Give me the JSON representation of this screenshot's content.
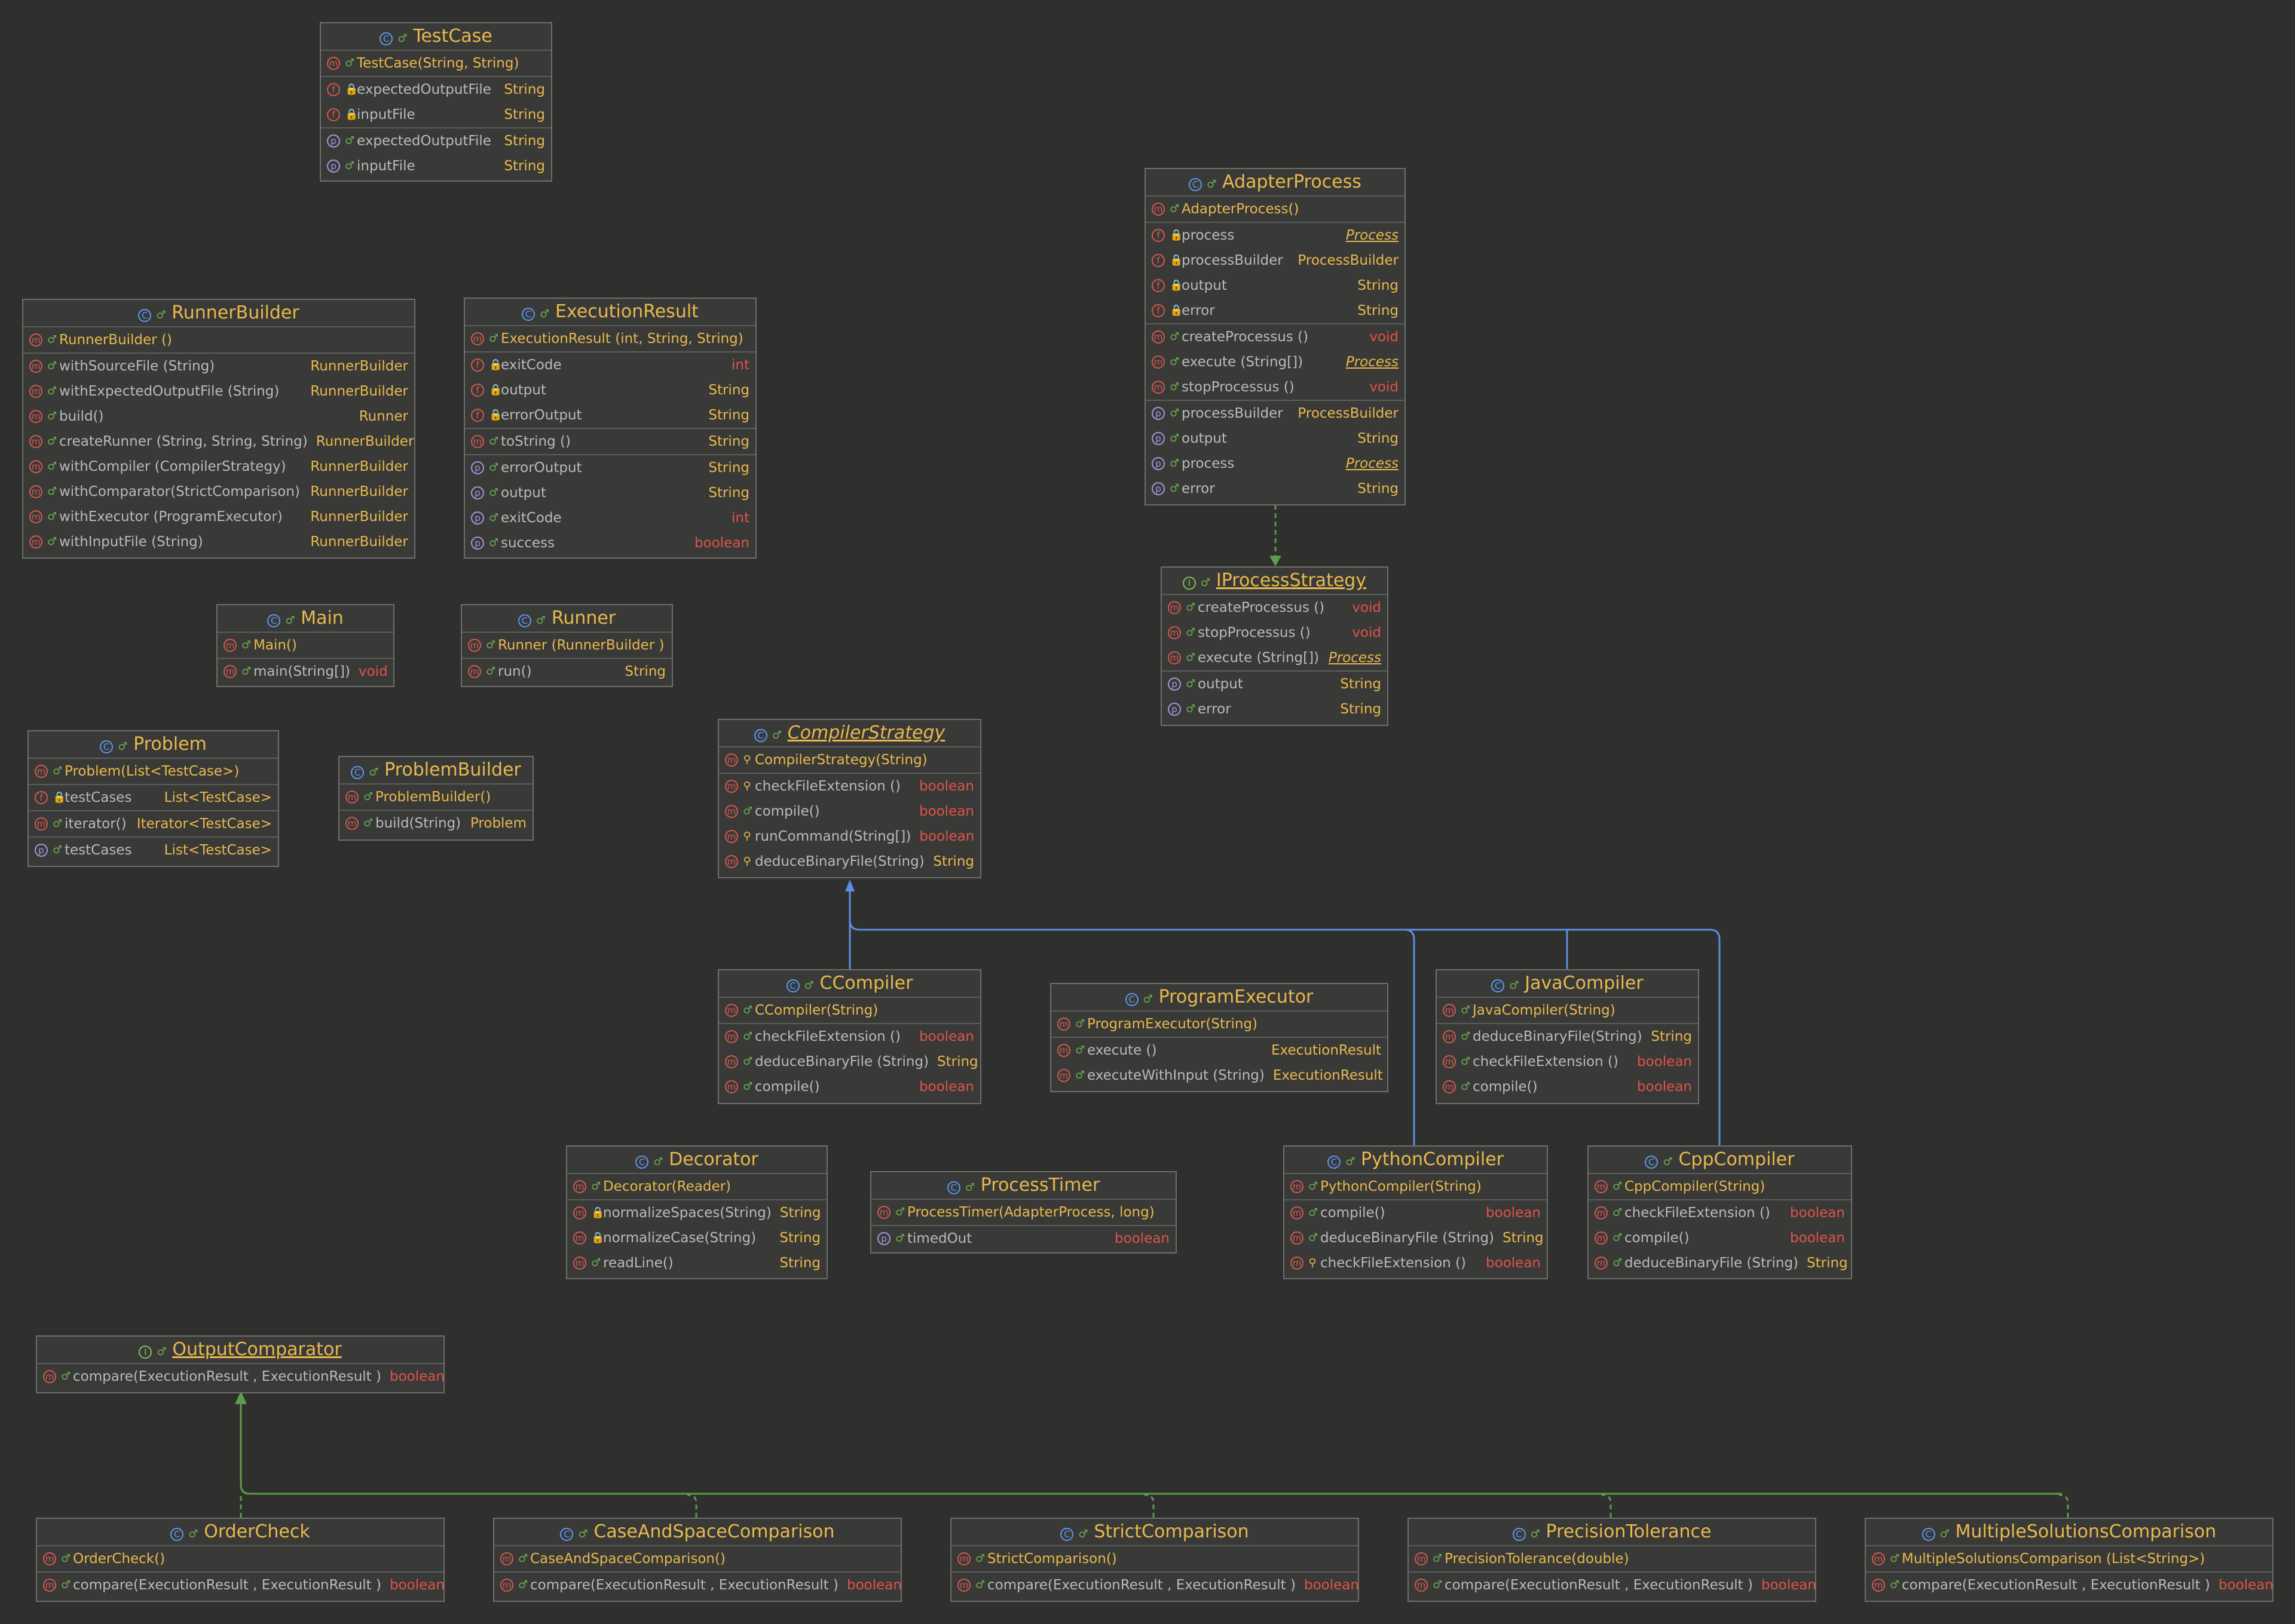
{
  "colors": {
    "background": "#2f2f2d",
    "box": "#393a38",
    "border": "#6d6f6c",
    "accent": "#e8b84c",
    "primitive": "#e0524a",
    "inheritance": "#5d8ee0",
    "realization": "#5e9b4a"
  },
  "classes": {
    "testcase": {
      "kind": "C",
      "title": "TestCase",
      "sections": [
        [
          {
            "k": "m",
            "v": "pub",
            "name": "TestCase(String, String)",
            "ctor": true
          }
        ],
        [
          {
            "k": "f",
            "v": "priv",
            "name": "expectedOutputFile",
            "type": "String"
          },
          {
            "k": "f",
            "v": "priv",
            "name": "inputFile",
            "type": "String"
          }
        ],
        [
          {
            "k": "p",
            "v": "pub",
            "name": "expectedOutputFile",
            "type": "String"
          },
          {
            "k": "p",
            "v": "pub",
            "name": "inputFile",
            "type": "String"
          }
        ]
      ]
    },
    "runnerbuilder": {
      "kind": "C",
      "title": "RunnerBuilder",
      "sections": [
        [
          {
            "k": "m",
            "v": "pub",
            "name": "RunnerBuilder ()",
            "ctor": true
          }
        ],
        [
          {
            "k": "m",
            "v": "pub",
            "name": "withSourceFile (String)",
            "type": "RunnerBuilder"
          },
          {
            "k": "m",
            "v": "pub",
            "name": "withExpectedOutputFile  (String)",
            "type": "RunnerBuilder"
          },
          {
            "k": "m",
            "v": "pub",
            "name": "build()",
            "type": "Runner"
          },
          {
            "k": "m",
            "v": "pub",
            "name": "createRunner (String, String, String)",
            "type": "RunnerBuilder"
          },
          {
            "k": "m",
            "v": "pub",
            "name": "withCompiler (CompilerStrategy)",
            "type": "RunnerBuilder"
          },
          {
            "k": "m",
            "v": "pub",
            "name": "withComparator(StrictComparison)",
            "type": "RunnerBuilder"
          },
          {
            "k": "m",
            "v": "pub",
            "name": "withExecutor (ProgramExecutor)",
            "type": "RunnerBuilder"
          },
          {
            "k": "m",
            "v": "pub",
            "name": "withInputFile  (String)",
            "type": "RunnerBuilder"
          }
        ]
      ]
    },
    "executionresult": {
      "kind": "C",
      "title": "ExecutionResult",
      "sections": [
        [
          {
            "k": "m",
            "v": "pub",
            "name": "ExecutionResult (int, String, String)",
            "ctor": true
          }
        ],
        [
          {
            "k": "f",
            "v": "priv",
            "name": "exitCode",
            "type": "int",
            "red": true
          },
          {
            "k": "f",
            "v": "priv",
            "name": "output",
            "type": "String"
          },
          {
            "k": "f",
            "v": "priv",
            "name": "errorOutput",
            "type": "String"
          }
        ],
        [
          {
            "k": "m",
            "v": "pub",
            "name": "toString ()",
            "type": "String"
          }
        ],
        [
          {
            "k": "p",
            "v": "pub",
            "name": "errorOutput",
            "type": "String"
          },
          {
            "k": "p",
            "v": "pub",
            "name": "output",
            "type": "String"
          },
          {
            "k": "p",
            "v": "pub",
            "name": "exitCode",
            "type": "int",
            "red": true
          },
          {
            "k": "p",
            "v": "pub",
            "name": "success",
            "type": "boolean",
            "red": true
          }
        ]
      ]
    },
    "adapterprocess": {
      "kind": "C",
      "title": "AdapterProcess",
      "sections": [
        [
          {
            "k": "m",
            "v": "pub",
            "name": "AdapterProcess()",
            "ctor": true
          }
        ],
        [
          {
            "k": "f",
            "v": "priv",
            "name": "process",
            "type": "Process",
            "it": true
          },
          {
            "k": "f",
            "v": "priv",
            "name": "processBuilder",
            "type": "ProcessBuilder"
          },
          {
            "k": "f",
            "v": "priv",
            "name": "output",
            "type": "String"
          },
          {
            "k": "f",
            "v": "priv",
            "name": "error",
            "type": "String"
          }
        ],
        [
          {
            "k": "m",
            "v": "pub",
            "name": "createProcessus ()",
            "type": "void",
            "red": true
          },
          {
            "k": "m",
            "v": "pub",
            "name": "execute (String[])",
            "type": "Process",
            "it": true
          },
          {
            "k": "m",
            "v": "pub",
            "name": "stopProcessus ()",
            "type": "void",
            "red": true
          }
        ],
        [
          {
            "k": "p",
            "v": "pub",
            "name": "processBuilder",
            "type": "ProcessBuilder"
          },
          {
            "k": "p",
            "v": "pub",
            "name": "output",
            "type": "String"
          },
          {
            "k": "p",
            "v": "pub",
            "name": "process",
            "type": "Process",
            "it": true
          },
          {
            "k": "p",
            "v": "pub",
            "name": "error",
            "type": "String"
          }
        ]
      ]
    },
    "iprocessstrategy": {
      "kind": "I",
      "title": "IProcessStrategy",
      "sections": [
        [
          {
            "k": "m",
            "v": "pub",
            "name": "createProcessus ()",
            "type": "void",
            "red": true
          },
          {
            "k": "m",
            "v": "pub",
            "name": "stopProcessus ()",
            "type": "void",
            "red": true
          },
          {
            "k": "m",
            "v": "pub",
            "name": "execute (String[])",
            "type": "Process",
            "it": true
          }
        ],
        [
          {
            "k": "p",
            "v": "pub",
            "name": "output",
            "type": "String"
          },
          {
            "k": "p",
            "v": "pub",
            "name": "error",
            "type": "String"
          }
        ]
      ]
    },
    "main": {
      "kind": "C",
      "title": "Main",
      "sections": [
        [
          {
            "k": "m",
            "v": "pub",
            "name": "Main()",
            "ctor": true
          }
        ],
        [
          {
            "k": "m",
            "v": "pub",
            "name": "main(String[])",
            "type": "void",
            "red": true
          }
        ]
      ]
    },
    "runner": {
      "kind": "C",
      "title": "Runner",
      "sections": [
        [
          {
            "k": "m",
            "v": "pub",
            "name": "Runner (RunnerBuilder )",
            "ctor": true
          }
        ],
        [
          {
            "k": "m",
            "v": "pub",
            "name": "run()",
            "type": "String"
          }
        ]
      ]
    },
    "problem": {
      "kind": "C",
      "title": "Problem",
      "sections": [
        [
          {
            "k": "m",
            "v": "pub",
            "name": "Problem(List<TestCase>)",
            "ctor": true
          }
        ],
        [
          {
            "k": "f",
            "v": "priv",
            "name": "testCases",
            "type": "List<TestCase>"
          }
        ],
        [
          {
            "k": "m",
            "v": "pub",
            "name": "iterator()",
            "type": "Iterator<TestCase>"
          }
        ],
        [
          {
            "k": "p",
            "v": "pub",
            "name": "testCases",
            "type": "List<TestCase>"
          }
        ]
      ]
    },
    "problembuilder": {
      "kind": "C",
      "title": "ProblemBuilder",
      "sections": [
        [
          {
            "k": "m",
            "v": "pub",
            "name": "ProblemBuilder()",
            "ctor": true
          }
        ],
        [
          {
            "k": "m",
            "v": "pub",
            "name": "build(String)",
            "type": "Problem"
          }
        ]
      ]
    },
    "compilerstrategy": {
      "kind": "C",
      "title": "CompilerStrategy",
      "abstract": true,
      "sections": [
        [
          {
            "k": "m",
            "v": "prot",
            "name": "CompilerStrategy(String)",
            "ctor": true
          }
        ],
        [
          {
            "k": "m",
            "v": "prot",
            "name": "checkFileExtension ()",
            "type": "boolean",
            "red": true
          },
          {
            "k": "m",
            "v": "pub",
            "name": "compile()",
            "type": "boolean",
            "red": true
          },
          {
            "k": "m",
            "v": "prot",
            "name": "runCommand(String[])",
            "type": "boolean",
            "red": true
          },
          {
            "k": "m",
            "v": "prot",
            "name": "deduceBinaryFile(String)",
            "type": "String"
          }
        ]
      ]
    },
    "ccompiler": {
      "kind": "C",
      "title": "CCompiler",
      "sections": [
        [
          {
            "k": "m",
            "v": "pub",
            "name": "CCompiler(String)",
            "ctor": true
          }
        ],
        [
          {
            "k": "m",
            "v": "pub",
            "name": "checkFileExtension ()",
            "type": "boolean",
            "red": true
          },
          {
            "k": "m",
            "v": "pub",
            "name": "deduceBinaryFile (String)",
            "type": "String"
          },
          {
            "k": "m",
            "v": "pub",
            "name": "compile()",
            "type": "boolean",
            "red": true
          }
        ]
      ]
    },
    "programexecutor": {
      "kind": "C",
      "title": "ProgramExecutor",
      "sections": [
        [
          {
            "k": "m",
            "v": "pub",
            "name": "ProgramExecutor(String)",
            "ctor": true
          }
        ],
        [
          {
            "k": "m",
            "v": "pub",
            "name": "execute ()",
            "type": "ExecutionResult"
          },
          {
            "k": "m",
            "v": "pub",
            "name": "executeWithInput  (String)",
            "type": "ExecutionResult"
          }
        ]
      ]
    },
    "javacompiler": {
      "kind": "C",
      "title": "JavaCompiler",
      "sections": [
        [
          {
            "k": "m",
            "v": "pub",
            "name": "JavaCompiler(String)",
            "ctor": true
          }
        ],
        [
          {
            "k": "m",
            "v": "pub",
            "name": "deduceBinaryFile(String)",
            "type": "String"
          },
          {
            "k": "m",
            "v": "pub",
            "name": "checkFileExtension ()",
            "type": "boolean",
            "red": true
          },
          {
            "k": "m",
            "v": "pub",
            "name": "compile()",
            "type": "boolean",
            "red": true
          }
        ]
      ]
    },
    "decorator": {
      "kind": "C",
      "title": "Decorator",
      "sections": [
        [
          {
            "k": "m",
            "v": "pub",
            "name": "Decorator(Reader)",
            "ctor": true
          }
        ],
        [
          {
            "k": "m",
            "v": "priv",
            "name": "normalizeSpaces(String)",
            "type": "String"
          },
          {
            "k": "m",
            "v": "priv",
            "name": "normalizeCase(String)",
            "type": "String"
          },
          {
            "k": "m",
            "v": "pub",
            "name": "readLine()",
            "type": "String"
          }
        ]
      ]
    },
    "processtimer": {
      "kind": "C",
      "title": "ProcessTimer",
      "sections": [
        [
          {
            "k": "m",
            "v": "pub",
            "name": "ProcessTimer(AdapterProcess, long)",
            "ctor": true
          }
        ],
        [
          {
            "k": "p",
            "v": "pub",
            "name": "timedOut",
            "type": "boolean",
            "red": true
          }
        ]
      ]
    },
    "pythoncompiler": {
      "kind": "C",
      "title": "PythonCompiler",
      "sections": [
        [
          {
            "k": "m",
            "v": "pub",
            "name": "PythonCompiler(String)",
            "ctor": true
          }
        ],
        [
          {
            "k": "m",
            "v": "pub",
            "name": "compile()",
            "type": "boolean",
            "red": true
          },
          {
            "k": "m",
            "v": "pub",
            "name": "deduceBinaryFile (String)",
            "type": "String"
          },
          {
            "k": "m",
            "v": "prot",
            "name": "checkFileExtension ()",
            "type": "boolean",
            "red": true
          }
        ]
      ]
    },
    "cppcompiler": {
      "kind": "C",
      "title": "CppCompiler",
      "sections": [
        [
          {
            "k": "m",
            "v": "pub",
            "name": "CppCompiler(String)",
            "ctor": true
          }
        ],
        [
          {
            "k": "m",
            "v": "pub",
            "name": "checkFileExtension ()",
            "type": "boolean",
            "red": true
          },
          {
            "k": "m",
            "v": "pub",
            "name": "compile()",
            "type": "boolean",
            "red": true
          },
          {
            "k": "m",
            "v": "pub",
            "name": "deduceBinaryFile (String)",
            "type": "String"
          }
        ]
      ]
    },
    "outputcomparator": {
      "kind": "I",
      "title": "OutputComparator",
      "sections": [
        [
          {
            "k": "m",
            "v": "pub",
            "name": "compare(ExecutionResult , ExecutionResult )",
            "type": "boolean",
            "red": true
          }
        ]
      ]
    },
    "ordercheck": {
      "kind": "C",
      "title": "OrderCheck",
      "sections": [
        [
          {
            "k": "m",
            "v": "pub",
            "name": "OrderCheck()",
            "ctor": true
          }
        ],
        [
          {
            "k": "m",
            "v": "pub",
            "name": "compare(ExecutionResult , ExecutionResult )",
            "type": "boolean",
            "red": true
          }
        ]
      ]
    },
    "caseandspacecomparison": {
      "kind": "C",
      "title": "CaseAndSpaceComparison",
      "sections": [
        [
          {
            "k": "m",
            "v": "pub",
            "name": "CaseAndSpaceComparison()",
            "ctor": true
          }
        ],
        [
          {
            "k": "m",
            "v": "pub",
            "name": "compare(ExecutionResult , ExecutionResult )",
            "type": "boolean",
            "red": true
          }
        ]
      ]
    },
    "strictcomparison": {
      "kind": "C",
      "title": "StrictComparison",
      "sections": [
        [
          {
            "k": "m",
            "v": "pub",
            "name": "StrictComparison()",
            "ctor": true
          }
        ],
        [
          {
            "k": "m",
            "v": "pub",
            "name": "compare(ExecutionResult , ExecutionResult )",
            "type": "boolean",
            "red": true
          }
        ]
      ]
    },
    "precisiontolerance": {
      "kind": "C",
      "title": "PrecisionTolerance",
      "sections": [
        [
          {
            "k": "m",
            "v": "pub",
            "name": "PrecisionTolerance(double)",
            "ctor": true
          }
        ],
        [
          {
            "k": "m",
            "v": "pub",
            "name": "compare(ExecutionResult , ExecutionResult )",
            "type": "boolean",
            "red": true
          }
        ]
      ]
    },
    "multiplesolutionscomparison": {
      "kind": "C",
      "title": "MultipleSolutionsComparison",
      "sections": [
        [
          {
            "k": "m",
            "v": "pub",
            "name": "MultipleSolutionsComparison (List<String>)",
            "ctor": true
          }
        ],
        [
          {
            "k": "m",
            "v": "pub",
            "name": "compare(ExecutionResult , ExecutionResult )",
            "type": "boolean",
            "red": true
          }
        ]
      ]
    }
  }
}
